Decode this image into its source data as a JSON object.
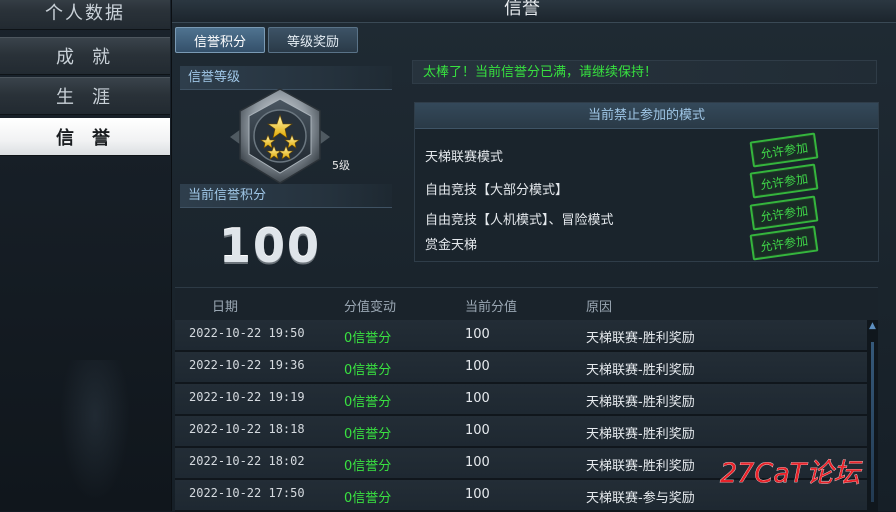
{
  "sidebar": {
    "items": [
      {
        "label": "个人数据",
        "active": false
      },
      {
        "label": "成就",
        "active": false
      },
      {
        "label": "生涯",
        "active": false
      },
      {
        "label": "信誉",
        "active": true
      }
    ]
  },
  "header": {
    "title": "信誉"
  },
  "tabs": [
    {
      "label": "信誉积分",
      "active": true
    },
    {
      "label": "等级奖励",
      "active": false
    }
  ],
  "credit": {
    "level_label": "信誉等级",
    "level_value": "5级",
    "score_label": "当前信誉积分",
    "score_value": "100"
  },
  "notice": "太棒了！当前信誉分已满，请继续保持！",
  "banned_modes": {
    "title": "当前禁止参加的模式",
    "rows": [
      {
        "mode": "天梯联赛模式",
        "status": "允许参加"
      },
      {
        "mode": "自由竞技【大部分模式】",
        "status": "允许参加"
      },
      {
        "mode": "自由竞技【人机模式】、冒险模式",
        "status": "允许参加"
      },
      {
        "mode": "赏金天梯",
        "status": "允许参加"
      }
    ]
  },
  "history": {
    "columns": [
      "日期",
      "分值变动",
      "当前分值",
      "原因"
    ],
    "rows": [
      {
        "date": "2022-10-22 19:50",
        "delta": "0信誉分",
        "current": "100",
        "reason": "天梯联赛-胜利奖励"
      },
      {
        "date": "2022-10-22 19:36",
        "delta": "0信誉分",
        "current": "100",
        "reason": "天梯联赛-胜利奖励"
      },
      {
        "date": "2022-10-22 19:19",
        "delta": "0信誉分",
        "current": "100",
        "reason": "天梯联赛-胜利奖励"
      },
      {
        "date": "2022-10-22 18:18",
        "delta": "0信誉分",
        "current": "100",
        "reason": "天梯联赛-胜利奖励"
      },
      {
        "date": "2022-10-22 18:02",
        "delta": "0信誉分",
        "current": "100",
        "reason": "天梯联赛-胜利奖励"
      },
      {
        "date": "2022-10-22 17:50",
        "delta": "0信誉分",
        "current": "100",
        "reason": "天梯联赛-参与奖励"
      }
    ]
  },
  "watermark": "27CaT论坛",
  "colors": {
    "accent_green": "#39e240",
    "label_blue": "#9fc6e6",
    "watermark_red": "#e8232a"
  },
  "icons": {
    "level_badge": "shield-stars-badge",
    "scroll_up": "triangle-up-icon"
  }
}
